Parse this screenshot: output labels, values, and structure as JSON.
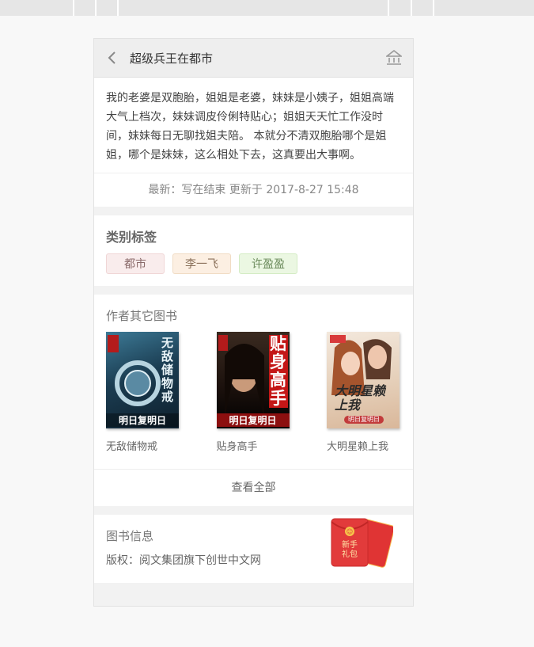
{
  "header": {
    "title": "超级兵王在都市"
  },
  "description": "我的老婆是双胞胎，姐姐是老婆，妹妹是小姨子，姐姐高端大气上档次，妹妹调皮伶俐特贴心；姐姐天天忙工作没时间，妹妹每日无聊找姐夫陪。 本就分不清双胞胎哪个是姐姐，哪个是妹妹，这么相处下去，这真要出大事啊。",
  "latest": "最新：写在结束 更新于 2017-8-27 15:48",
  "tags": {
    "title": "类别标签",
    "items": [
      "都市",
      "李一飞",
      "许盈盈"
    ]
  },
  "other_books": {
    "title": "作者其它图书",
    "items": [
      {
        "name": "无敌储物戒",
        "cover_text": "无敌储物戒",
        "cover_author": "明日复明日",
        "cover_color": "#1f4a63"
      },
      {
        "name": "贴身高手",
        "cover_text": "贴身高手",
        "cover_author": "明日复明日",
        "cover_color": "#2a1a14"
      },
      {
        "name": "大明星赖上我",
        "cover_text": "大明星赖上我",
        "cover_author": "明日复明日",
        "cover_color": "#e8d8c8"
      }
    ],
    "view_all": "查看全部"
  },
  "book_info": {
    "title": "图书信息",
    "copyright": "版权：阅文集团旗下创世中文网"
  },
  "red_packet": {
    "label_line1": "新手",
    "label_line2": "礼包"
  }
}
